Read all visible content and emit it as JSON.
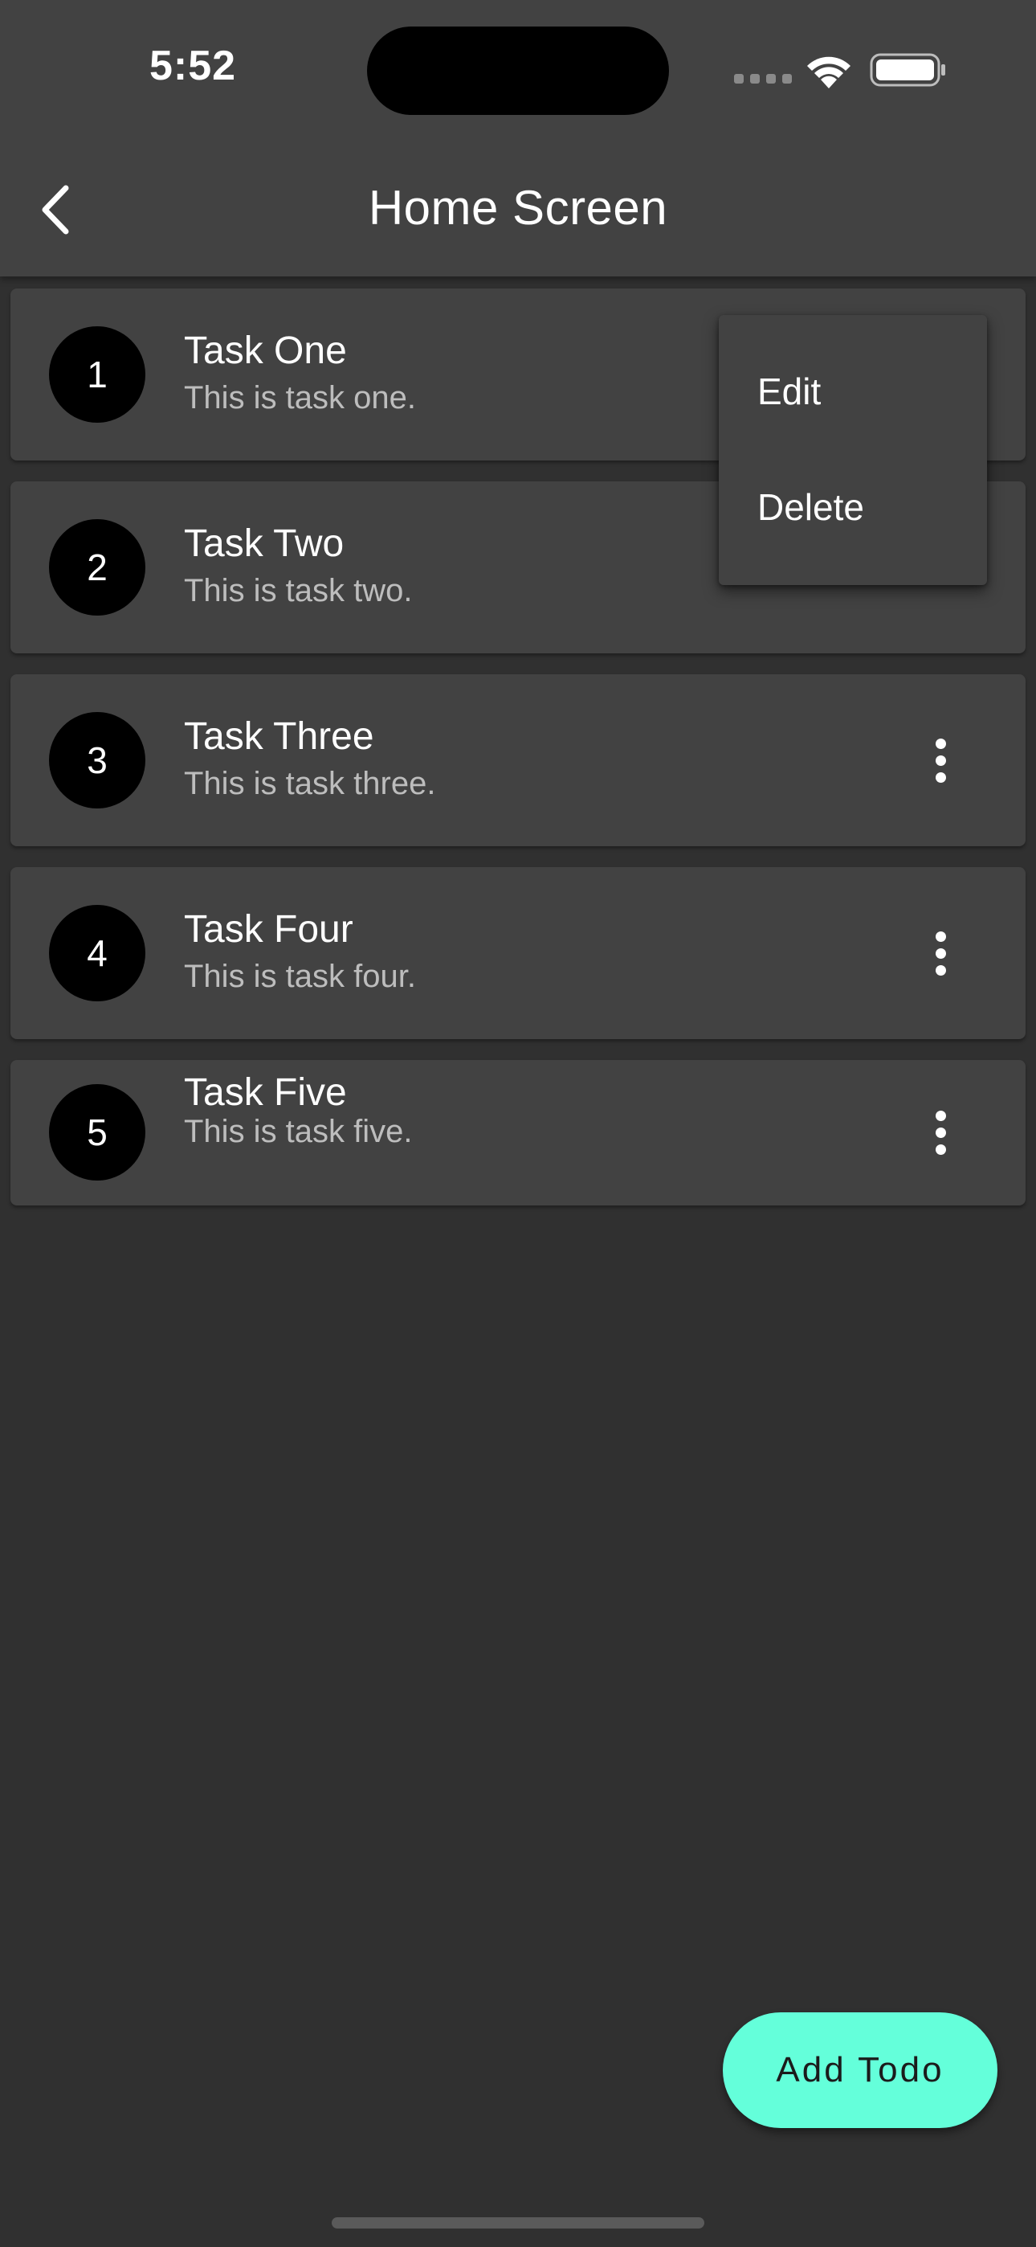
{
  "status_bar": {
    "time": "5:52"
  },
  "app_bar": {
    "title": "Home Screen"
  },
  "tasks": [
    {
      "number": "1",
      "title": "Task One",
      "description": "This is task one."
    },
    {
      "number": "2",
      "title": "Task Two",
      "description": "This is task two."
    },
    {
      "number": "3",
      "title": "Task Three",
      "description": "This is task three."
    },
    {
      "number": "4",
      "title": "Task Four",
      "description": "This is task four."
    },
    {
      "number": "5",
      "title": "Task Five",
      "description": "This is task five."
    }
  ],
  "popup_menu": {
    "items": [
      "Edit",
      "Delete"
    ]
  },
  "fab": {
    "label": "Add Todo"
  },
  "colors": {
    "background": "#303030",
    "surface": "#424242",
    "accent": "#64ffda"
  }
}
